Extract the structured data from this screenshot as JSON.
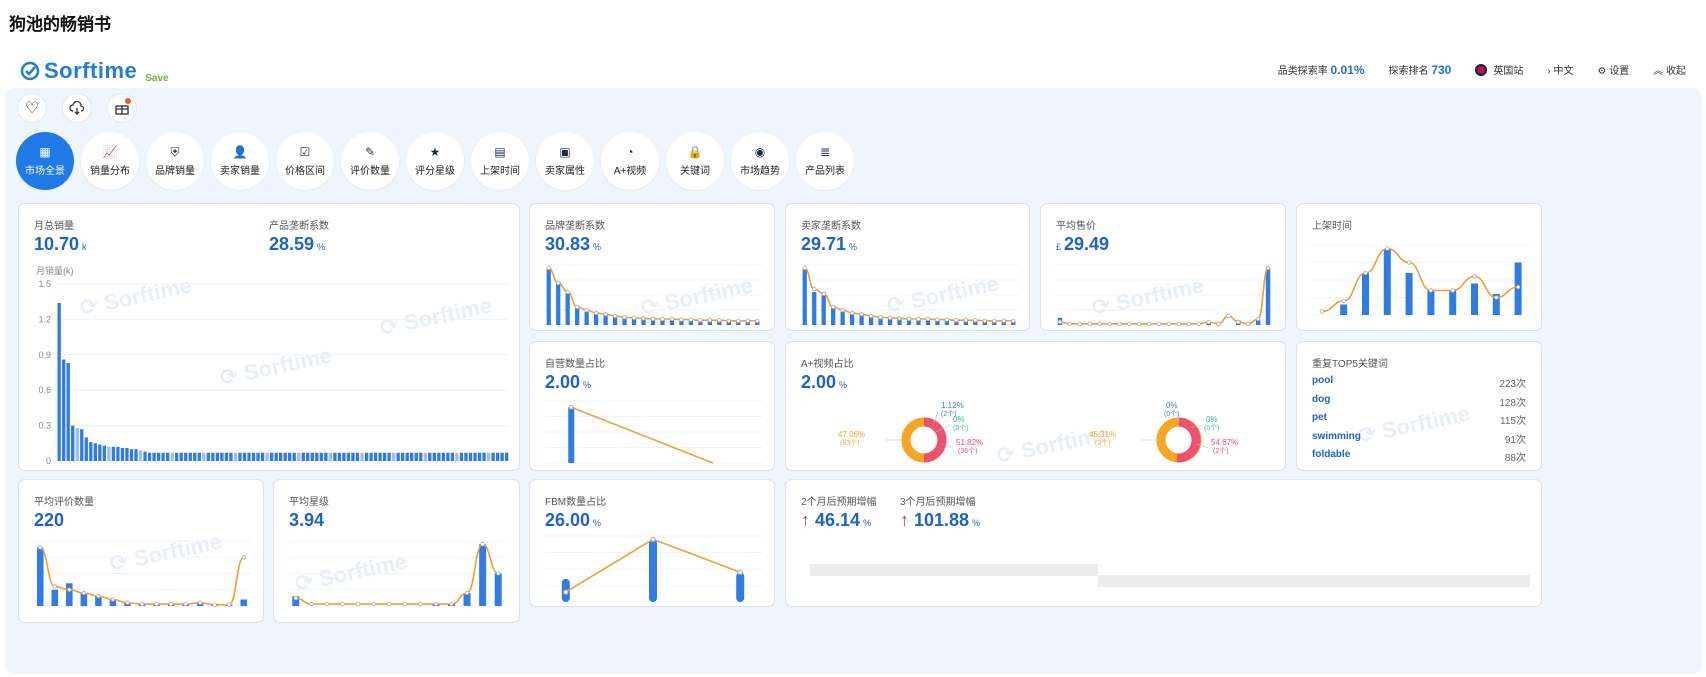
{
  "page_title": "狗池的畅销书",
  "brand": {
    "name": "Sorftime",
    "tag": "Save"
  },
  "topbar": {
    "category_label": "品类探索率",
    "category_value": "0.01%",
    "rank_label": "探索排名",
    "rank_value": "730",
    "site": "英国站",
    "lang": "中文",
    "settings": "设置",
    "collapse": "收起"
  },
  "nav": [
    {
      "label": "市场全景",
      "icon": "grid-icon",
      "active": true
    },
    {
      "label": "销量分布",
      "icon": "chart-icon"
    },
    {
      "label": "品牌销量",
      "icon": "shield-icon"
    },
    {
      "label": "卖家销量",
      "icon": "user-icon"
    },
    {
      "label": "价格区间",
      "icon": "check-box-icon"
    },
    {
      "label": "评价数量",
      "icon": "edit-icon"
    },
    {
      "label": "评分星级",
      "icon": "star-icon"
    },
    {
      "label": "上架时间",
      "icon": "calendar-icon"
    },
    {
      "label": "卖家属性",
      "icon": "store-icon"
    },
    {
      "label": "A+视频",
      "icon": "pie-icon"
    },
    {
      "label": "关键词",
      "icon": "lock-icon"
    },
    {
      "label": "市场趋势",
      "icon": "compass-icon"
    },
    {
      "label": "产品列表",
      "icon": "list-icon"
    }
  ],
  "cards": {
    "monthly_sales": {
      "label": "月总销量",
      "value": "10.70",
      "unit": "k",
      "axis_label": "月销量(k)",
      "ticks": [
        "1.5",
        "1.2",
        "0.9",
        "0.6",
        "0.3",
        "0"
      ]
    },
    "product_concentration": {
      "label": "产品垄断系数",
      "value": "28.59",
      "unit": "%"
    },
    "brand_concentration": {
      "label": "品牌垄断系数",
      "value": "30.83",
      "unit": "%"
    },
    "seller_concentration": {
      "label": "卖家垄断系数",
      "value": "29.71",
      "unit": "%"
    },
    "avg_price": {
      "label": "平均售价",
      "currency": "£",
      "value": "29.49"
    },
    "listing_time": {
      "label": "上架时间"
    },
    "self_operated": {
      "label": "自营数量占比",
      "value": "2.00",
      "unit": "%"
    },
    "aplus_video": {
      "label": "A+视频占比",
      "value": "2.00",
      "unit": "%",
      "donut_left": {
        "a": "1.12%",
        "a2": "(2个)",
        "b": "0%",
        "b2": "(0个)",
        "c": "47.06%",
        "c2": "(83个)",
        "d": "51.82%",
        "d2": "(36个)"
      },
      "donut_right": {
        "a": "0%",
        "a2": "(0个)",
        "b": "0%",
        "b2": "(0个)",
        "c": "45.31%",
        "c2": "(3个)",
        "d": "54.67%",
        "d2": "(2个)"
      }
    },
    "keywords": {
      "label": "重复TOP5关键词",
      "items": [
        {
          "word": "pool",
          "count": "223次"
        },
        {
          "word": "dog",
          "count": "128次"
        },
        {
          "word": "pet",
          "count": "115次"
        },
        {
          "word": "swimming",
          "count": "91次"
        },
        {
          "word": "foldable",
          "count": "88次"
        }
      ]
    },
    "avg_reviews": {
      "label": "平均评价数量",
      "value": "220"
    },
    "avg_rating": {
      "label": "平均星级",
      "value": "3.94"
    },
    "fbm": {
      "label": "FBM数量占比",
      "value": "26.00",
      "unit": "%"
    },
    "forecast": {
      "label_2m": "2个月后预期增幅",
      "value_2m": "46.14",
      "label_3m": "3个月后预期增幅",
      "value_3m": "101.88",
      "unit": "%"
    }
  },
  "colors": {
    "accent": "#1f7ae6",
    "bar": "#2f7be8",
    "line": "#f0a030",
    "value": "#1f62c9",
    "donut_orange": "#f5a623",
    "donut_red": "#f0506e"
  },
  "chart_data": [
    {
      "type": "bar",
      "name": "monthly_sales",
      "ylim": [
        0,
        1.5
      ],
      "values": [
        1.34,
        0.86,
        0.83,
        0.3,
        0.28,
        0.27,
        0.2,
        0.16,
        0.15,
        0.14,
        0.13,
        0.12,
        0.12,
        0.12,
        0.11,
        0.11,
        0.1,
        0.1,
        0.09,
        0.08,
        0.07,
        0.07,
        0.07,
        0.07,
        0.07,
        0.07,
        0.07,
        0.07,
        0.07,
        0.07,
        0.07,
        0.07,
        0.07,
        0.07,
        0.07,
        0.07,
        0.07,
        0.07,
        0.07,
        0.07,
        0.07,
        0.07,
        0.07,
        0.07,
        0.07,
        0.07,
        0.07,
        0.07,
        0.07,
        0.07,
        0.07,
        0.07,
        0.07,
        0.07,
        0.07,
        0.07,
        0.07,
        0.07,
        0.07,
        0.07,
        0.07,
        0.07,
        0.07,
        0.07,
        0.07,
        0.07,
        0.07,
        0.07,
        0.07,
        0.07,
        0.07,
        0.07,
        0.07,
        0.07,
        0.07,
        0.07,
        0.07,
        0.07,
        0.07,
        0.07,
        0.07,
        0.07,
        0.07,
        0.07,
        0.07,
        0.07,
        0.07,
        0.07,
        0.07,
        0.07,
        0.07,
        0.07,
        0.07,
        0.07,
        0.07,
        0.07,
        0.07,
        0.07,
        0.07,
        0.07
      ]
    },
    {
      "type": "bar",
      "name": "brand_concentration",
      "values": [
        0.95,
        0.72,
        0.55,
        0.3,
        0.22,
        0.22,
        0.2,
        0.15,
        0.12,
        0.12,
        0.1,
        0.1,
        0.1,
        0.09,
        0.09,
        0.08,
        0.08,
        0.08,
        0.07,
        0.07,
        0.07,
        0.07,
        0.07
      ],
      "line": [
        0.95,
        0.7,
        0.55,
        0.3,
        0.25,
        0.2,
        0.18,
        0.15,
        0.13,
        0.12,
        0.11,
        0.1,
        0.1,
        0.1,
        0.09,
        0.09,
        0.08,
        0.08,
        0.08,
        0.07,
        0.07,
        0.07,
        0.07
      ]
    },
    {
      "type": "bar",
      "name": "seller_concentration",
      "values": [
        0.95,
        0.55,
        0.55,
        0.3,
        0.22,
        0.22,
        0.2,
        0.15,
        0.12,
        0.12,
        0.1,
        0.1,
        0.1,
        0.09,
        0.09,
        0.08,
        0.08,
        0.08,
        0.07,
        0.07,
        0.07,
        0.07,
        0.07
      ],
      "line": [
        0.95,
        0.6,
        0.52,
        0.3,
        0.25,
        0.2,
        0.18,
        0.15,
        0.13,
        0.12,
        0.11,
        0.1,
        0.1,
        0.1,
        0.09,
        0.09,
        0.08,
        0.08,
        0.08,
        0.07,
        0.07,
        0.07,
        0.07
      ]
    },
    {
      "type": "bar",
      "name": "avg_price",
      "values": [
        0.12,
        0,
        0,
        0,
        0,
        0,
        0,
        0,
        0,
        0,
        0,
        0,
        0,
        0,
        0,
        0.05,
        0,
        0,
        0.08,
        0,
        0.1,
        0.95
      ],
      "line": [
        0.05,
        0.02,
        0.02,
        0.02,
        0.02,
        0.02,
        0.02,
        0.02,
        0.02,
        0.02,
        0.02,
        0.02,
        0.02,
        0.02,
        0.02,
        0.05,
        0.02,
        0.15,
        0.05,
        0.02,
        0.1,
        0.95
      ]
    },
    {
      "type": "bar",
      "name": "listing_time",
      "values": [
        0,
        0.15,
        0.6,
        0.95,
        0.6,
        0.35,
        0.35,
        0.45,
        0.3,
        0.75
      ],
      "line": [
        0.05,
        0.2,
        0.6,
        0.95,
        0.75,
        0.35,
        0.35,
        0.55,
        0.25,
        0.4
      ]
    },
    {
      "type": "bar",
      "name": "avg_reviews",
      "values": [
        0.9,
        0.25,
        0.35,
        0.2,
        0.15,
        0.1,
        0.05,
        0.03,
        0.03,
        0.03,
        0.03,
        0.05,
        0.02,
        0.02,
        0.1
      ],
      "line": [
        0.9,
        0.3,
        0.25,
        0.2,
        0.15,
        0.1,
        0.05,
        0.03,
        0.03,
        0.03,
        0.03,
        0.05,
        0.02,
        0.02,
        0.75
      ]
    },
    {
      "type": "bar",
      "name": "avg_rating",
      "values": [
        0.15,
        0,
        0,
        0,
        0,
        0,
        0,
        0,
        0,
        0.03,
        0.03,
        0.2,
        0.95,
        0.5
      ],
      "line": [
        0.12,
        0.03,
        0.03,
        0.03,
        0.03,
        0.03,
        0.03,
        0.03,
        0.03,
        0.03,
        0.03,
        0.2,
        0.95,
        0.5
      ]
    },
    {
      "type": "bar",
      "name": "self_operated",
      "values": [
        0.9,
        0,
        0,
        0
      ],
      "line": [
        0.9,
        0.6,
        0.3,
        0
      ]
    },
    {
      "type": "bar",
      "name": "fbm",
      "values": [
        0.35,
        0,
        0.95,
        0,
        0.45
      ],
      "line": [
        0.15,
        0.55,
        0.95,
        0.7,
        0.45
      ]
    }
  ]
}
